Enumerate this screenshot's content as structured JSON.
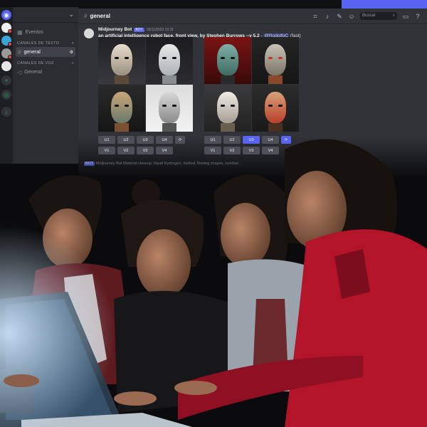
{
  "server": {
    "name": ""
  },
  "channels": {
    "events_label": "Eventos",
    "text_category": "CANALES DE TEXTO",
    "text_channel": "general",
    "voice_category": "CANALES DE VOZ",
    "voice_channel": "General"
  },
  "header": {
    "channel": "general",
    "search_placeholder": "Buscar"
  },
  "message": {
    "author": "Midjourney Bot",
    "bot_tag": "BOT",
    "timestamp": "18/11/2023 19:11",
    "prompt": "an artificial intelligence robot face, front view, by Stephen Burrows --v 5.2",
    "separator": " - ",
    "mention": "@RodolfoC",
    "speed": "(fast)"
  },
  "buttons_left": {
    "upscale": [
      "U1",
      "U2",
      "U3",
      "U4"
    ],
    "variation": [
      "V1",
      "V2",
      "V3",
      "V4"
    ]
  },
  "buttons_right": {
    "upscale": [
      "U1",
      "U2",
      "U3",
      "U4"
    ],
    "variation": [
      "V1",
      "V2",
      "V3",
      "V4"
    ]
  },
  "next_message": {
    "bot_tag": "BOT",
    "author": "Midjourney Bot",
    "text": "Material closeup, liquid Hydrogen, melted, flowing shapes, number..."
  },
  "colors": {
    "accent": "#5865f2",
    "bg_main": "#313338",
    "bg_sidebar": "#2b2d31",
    "bg_rail": "#1e1f22",
    "hoodie_red": "#b3142a"
  }
}
